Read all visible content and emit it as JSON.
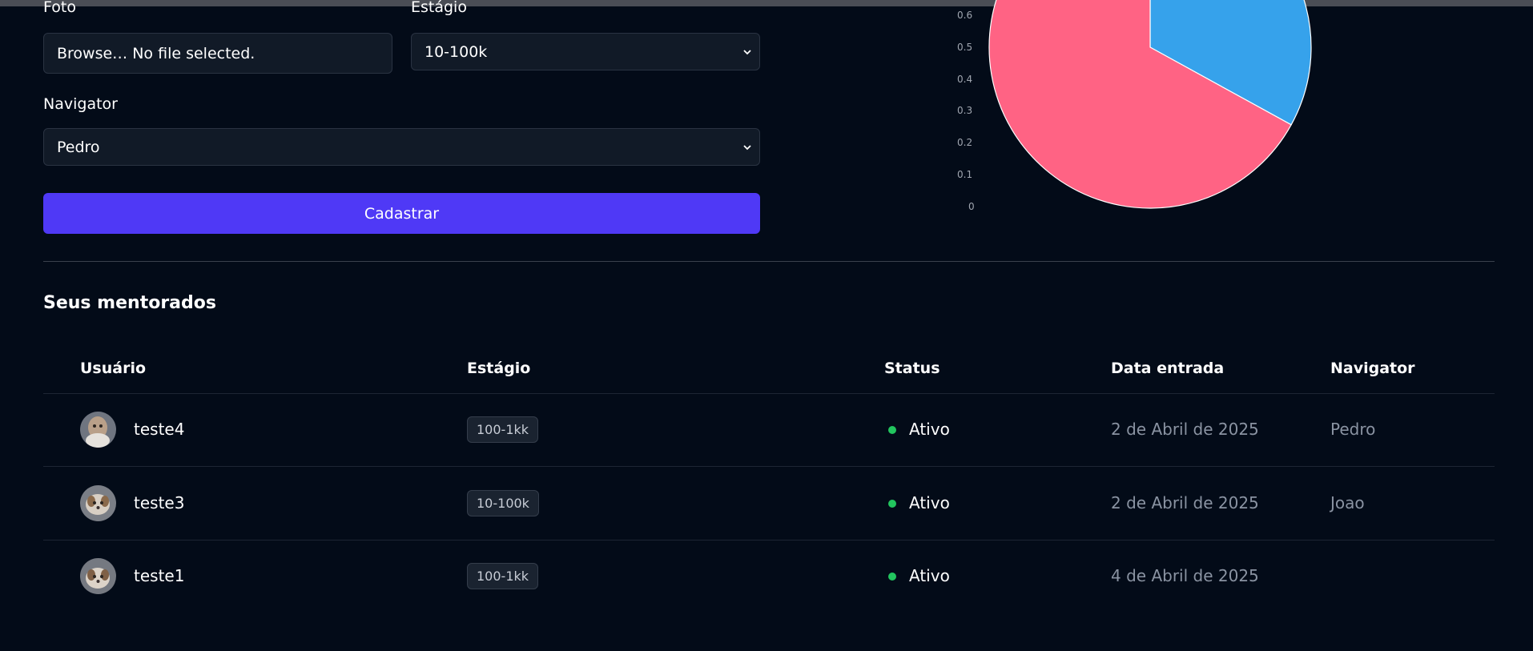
{
  "form": {
    "photo_label": "Foto",
    "photo_value": "Browse… No file selected.",
    "stage_label": "Estágio",
    "stage_value": "10-100k",
    "navigator_label": "Navigator",
    "navigator_value": "Pedro",
    "submit_label": "Cadastrar"
  },
  "chart_data": {
    "type": "pie",
    "slices": [
      {
        "label": "",
        "value": 0.33,
        "color": "#36a2eb"
      },
      {
        "label": "",
        "value": 0.67,
        "color": "#ff6384"
      }
    ],
    "yticks": [
      "0.6",
      "0.5",
      "0.4",
      "0.3",
      "0.2",
      "0.1",
      "0"
    ]
  },
  "mentees": {
    "title": "Seus mentorados",
    "columns": [
      "Usuário",
      "Estágio",
      "Status",
      "Data entrada",
      "Navigator"
    ],
    "rows": [
      {
        "user": "teste4",
        "stage": "100-1kk",
        "status": "Ativo",
        "date": "2 de Abril de 2025",
        "navigator": "Pedro"
      },
      {
        "user": "teste3",
        "stage": "10-100k",
        "status": "Ativo",
        "date": "2 de Abril de 2025",
        "navigator": "Joao"
      },
      {
        "user": "teste1",
        "stage": "100-1kk",
        "status": "Ativo",
        "date": "4 de Abril de 2025",
        "navigator": ""
      }
    ]
  },
  "colors": {
    "background": "#030b18",
    "accent": "#4f39f6",
    "status_active": "#22c55e"
  }
}
